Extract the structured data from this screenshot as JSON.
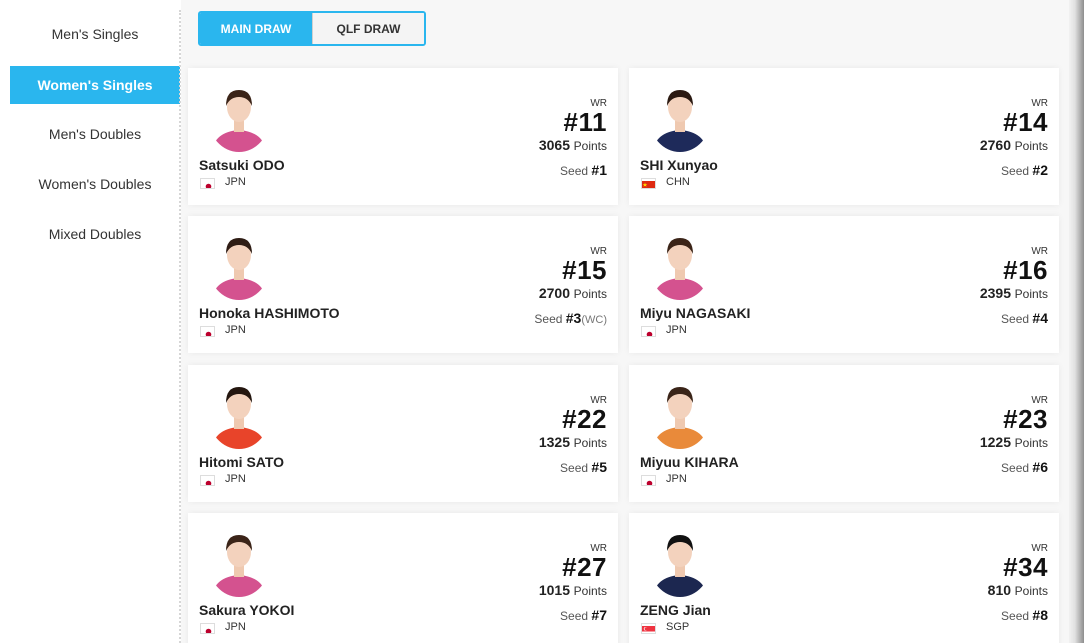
{
  "sidebar": {
    "items": [
      {
        "label": "Men's Singles",
        "active": false
      },
      {
        "label": "Women's Singles",
        "active": true
      },
      {
        "label": "Men's Doubles",
        "active": false
      },
      {
        "label": "Women's Doubles",
        "active": false
      },
      {
        "label": "Mixed Doubles",
        "active": false
      }
    ]
  },
  "toggle": {
    "main_draw": "MAIN DRAW",
    "qlf_draw": "QLF DRAW"
  },
  "labels": {
    "wr": "WR",
    "points": "Points",
    "seed": "Seed"
  },
  "players": [
    {
      "name": "Satsuki ODO",
      "country": "JPN",
      "rank": "#11",
      "points": "3065",
      "seed": "#1",
      "seed_note": "",
      "shirt": "#d4528f",
      "hair": "#3b2418"
    },
    {
      "name": "SHI Xunyao",
      "country": "CHN",
      "rank": "#14",
      "points": "2760",
      "seed": "#2",
      "seed_note": "",
      "shirt": "#1e2a5a",
      "hair": "#2b1a12"
    },
    {
      "name": "Honoka HASHIMOTO",
      "country": "JPN",
      "rank": "#15",
      "points": "2700",
      "seed": "#3",
      "seed_note": "(WC)",
      "shirt": "#d4528f",
      "hair": "#2e1c14"
    },
    {
      "name": "Miyu NAGASAKI",
      "country": "JPN",
      "rank": "#16",
      "points": "2395",
      "seed": "#4",
      "seed_note": "",
      "shirt": "#d4528f",
      "hair": "#3b2418"
    },
    {
      "name": "Hitomi SATO",
      "country": "JPN",
      "rank": "#22",
      "points": "1325",
      "seed": "#5",
      "seed_note": "",
      "shirt": "#e8442a",
      "hair": "#24160f"
    },
    {
      "name": "Miyuu KIHARA",
      "country": "JPN",
      "rank": "#23",
      "points": "1225",
      "seed": "#6",
      "seed_note": "",
      "shirt": "#e98a3a",
      "hair": "#3a2418"
    },
    {
      "name": "Sakura YOKOI",
      "country": "JPN",
      "rank": "#27",
      "points": "1015",
      "seed": "#7",
      "seed_note": "",
      "shirt": "#d4528f",
      "hair": "#3b2418"
    },
    {
      "name": "ZENG Jian",
      "country": "SGP",
      "rank": "#34",
      "points": "810",
      "seed": "#8",
      "seed_note": "",
      "shirt": "#1c2750",
      "hair": "#111111"
    }
  ],
  "colors": {
    "accent": "#2ab6ee"
  }
}
